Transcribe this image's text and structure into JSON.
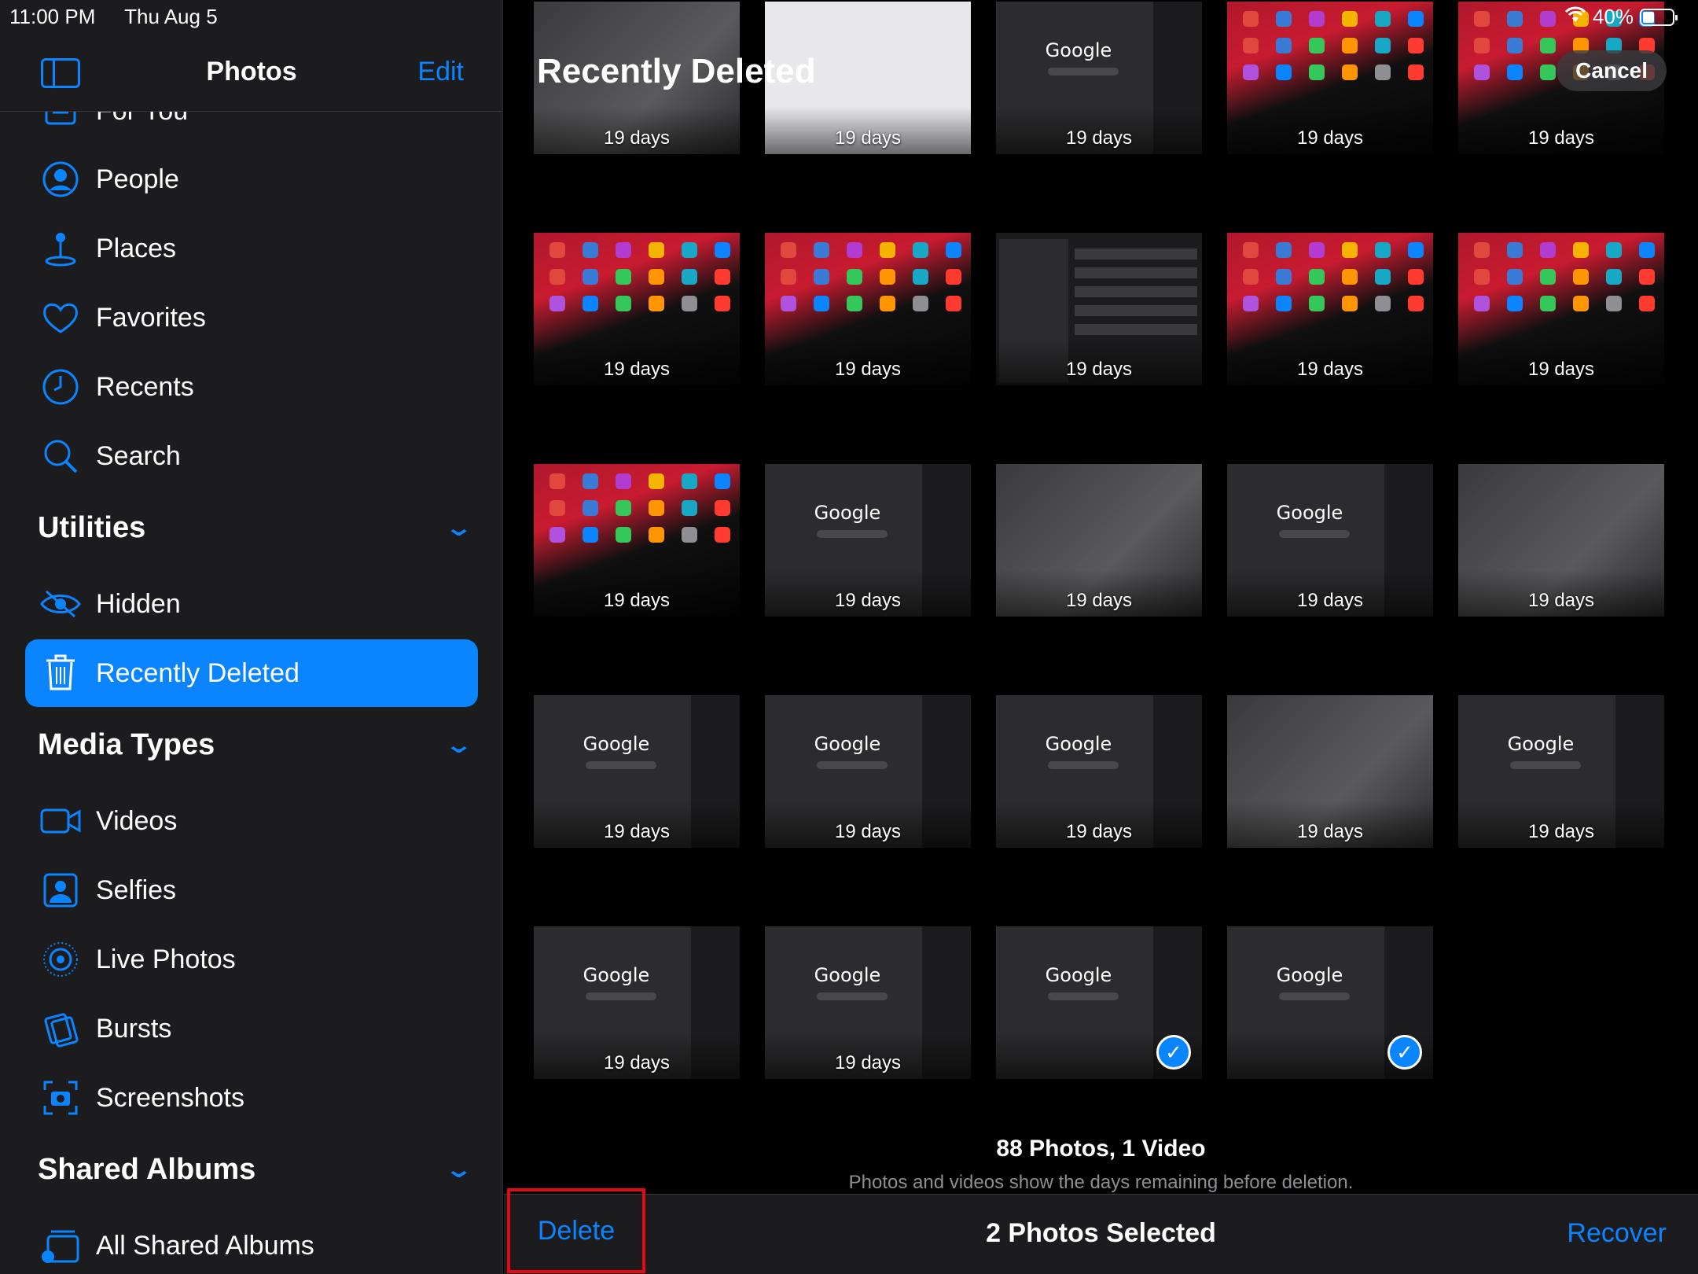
{
  "status": {
    "time": "11:00 PM",
    "date": "Thu Aug 5",
    "battery": "40%",
    "battery_fraction": 0.4
  },
  "sidebar": {
    "title": "Photos",
    "edit_label": "Edit",
    "items_top": [
      {
        "label": "For You",
        "icon": "for-you-icon"
      },
      {
        "label": "People",
        "icon": "person-circle-icon"
      },
      {
        "label": "Places",
        "icon": "map-pin-icon"
      },
      {
        "label": "Favorites",
        "icon": "heart-icon"
      },
      {
        "label": "Recents",
        "icon": "clock-icon"
      },
      {
        "label": "Search",
        "icon": "search-icon"
      }
    ],
    "sections": {
      "utilities": "Utilities",
      "media_types": "Media Types",
      "shared_albums": "Shared Albums"
    },
    "utilities_items": [
      {
        "label": "Hidden",
        "icon": "eye-slash-icon"
      },
      {
        "label": "Recently Deleted",
        "icon": "trash-icon",
        "active": true
      }
    ],
    "media_items": [
      {
        "label": "Videos",
        "icon": "video-icon"
      },
      {
        "label": "Selfies",
        "icon": "selfie-icon"
      },
      {
        "label": "Live Photos",
        "icon": "live-photo-icon"
      },
      {
        "label": "Bursts",
        "icon": "bursts-icon"
      },
      {
        "label": "Screenshots",
        "icon": "screenshot-icon"
      }
    ],
    "shared_items": [
      {
        "label": "All Shared Albums",
        "icon": "shared-albums-icon"
      }
    ]
  },
  "main": {
    "title": "Recently Deleted",
    "cancel_label": "Cancel",
    "thumb_days": "19 days",
    "google_text": "Google",
    "thumbs": [
      "blur",
      "social",
      "dark",
      "wall",
      "wall",
      "wall",
      "wall",
      "settings",
      "wall",
      "wall",
      "wall",
      "dark",
      "blur",
      "dark",
      "blur",
      "dark",
      "dark",
      "dark",
      "blur",
      "dark",
      "dark",
      "dark",
      "dark-selected",
      "dark-selected"
    ],
    "summary_count": "88 Photos, 1 Video",
    "summary_note": "Photos and videos show the days remaining before deletion."
  },
  "toolbar": {
    "delete_label": "Delete",
    "selected_label": "2 Photos Selected",
    "recover_label": "Recover"
  },
  "colors": {
    "accent": "#0a84ff",
    "highlight_box": "#e50914",
    "sidebar_bg": "#1c1c1e"
  }
}
